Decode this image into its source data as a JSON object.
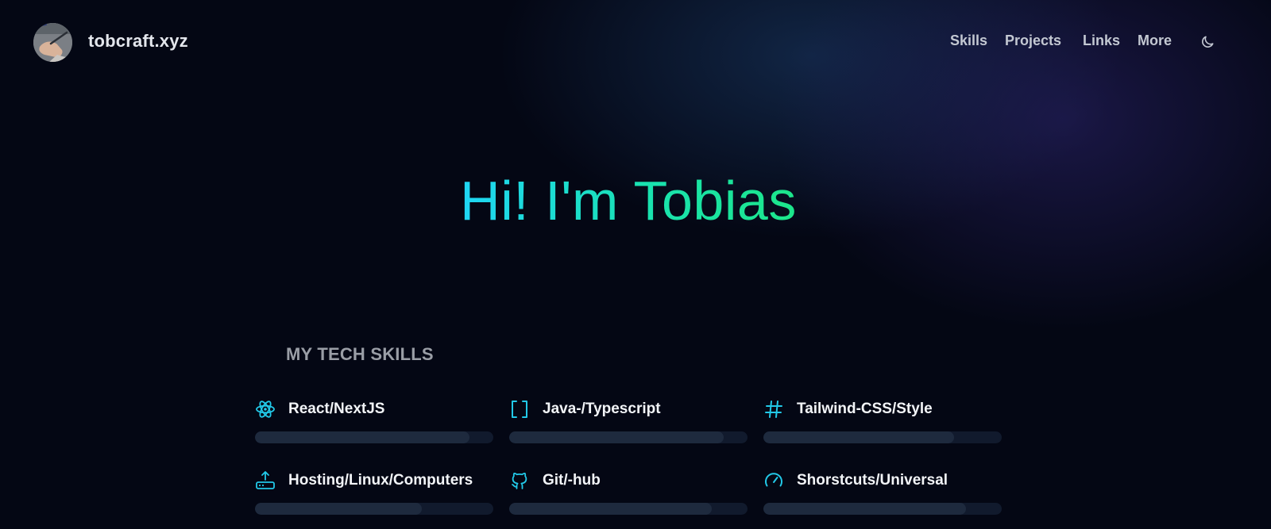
{
  "header": {
    "brand": "tobcraft.xyz",
    "nav": [
      "Skills",
      "Projects",
      "Links",
      "More"
    ],
    "theme_toggle_icon": "moon-icon"
  },
  "hero": {
    "title": "Hi! I'm Tobias"
  },
  "skills": {
    "heading": "MY TECH SKILLS",
    "items": [
      {
        "name": "React/NextJS",
        "icon": "react-icon",
        "level": 0.9
      },
      {
        "name": "Java-/Typescript",
        "icon": "brackets-icon",
        "level": 0.9
      },
      {
        "name": "Tailwind-CSS/Style",
        "icon": "hash-icon",
        "level": 0.8
      },
      {
        "name": "Hosting/Linux/Computers",
        "icon": "router-upload-icon",
        "level": 0.7
      },
      {
        "name": "Git/-hub",
        "icon": "github-icon",
        "level": 0.85
      },
      {
        "name": "Shorstcuts/Universal",
        "icon": "gauge-icon",
        "level": 0.85
      }
    ]
  },
  "colors": {
    "background": "#040714",
    "accent_cyan": "#1fd6f5",
    "accent_green": "#1ce68a",
    "icon": "#22c9e8"
  }
}
